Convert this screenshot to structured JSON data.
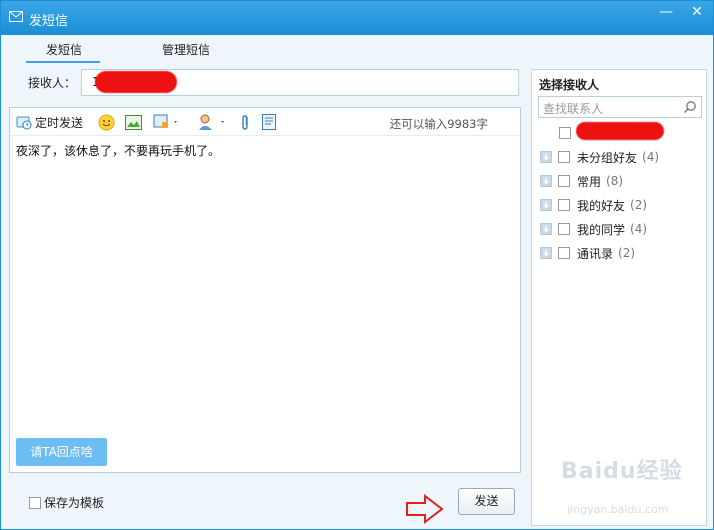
{
  "window": {
    "title": "发短信",
    "minimize": "—",
    "close": "✕"
  },
  "tabs": {
    "send": "发短信",
    "manage": "管理短信"
  },
  "recipient": {
    "label": "接收人：",
    "value": "1"
  },
  "toolbar": {
    "scheduled_send": "定时发送",
    "remaining": "还可以输入9983字"
  },
  "message": {
    "text": "夜深了，该休息了，不要再玩手机了。"
  },
  "reply_button": "请TA回点啥",
  "save_template": "保存为模板",
  "send_button": "发送",
  "panel": {
    "title": "选择接收人",
    "search_placeholder": "查找联系人",
    "groups": [
      {
        "label": "未分组好友",
        "count": "(4)"
      },
      {
        "label": "常用",
        "count": "(8)"
      },
      {
        "label": "我的好友",
        "count": "(2)"
      },
      {
        "label": "我的同学",
        "count": "(4)"
      },
      {
        "label": "通讯录",
        "count": "(2)"
      }
    ]
  },
  "watermark": {
    "brand": "Baidu经验",
    "url": "jingyan.baidu.com"
  },
  "colors": {
    "titlebar": "#1a8fd6",
    "accent": "#3b9fe0",
    "reply_button": "#6cbdf2",
    "arrow": "#e02020",
    "redaction": "#ee1111"
  }
}
